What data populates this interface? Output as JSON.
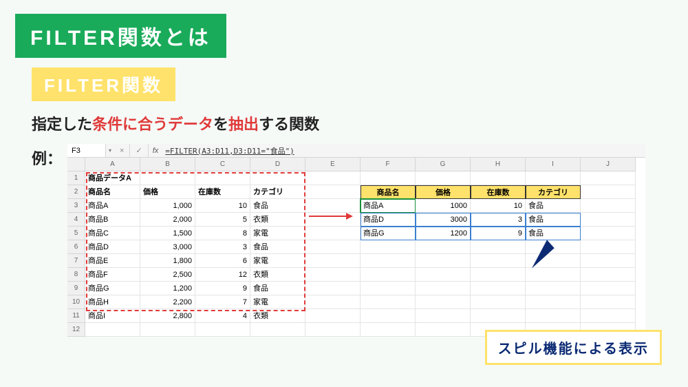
{
  "title": "FILTER関数とは",
  "subtitle": "FILTER関数",
  "description": {
    "p1": "指定した",
    "r1": "条件に合うデータ",
    "p2": "を",
    "r2": "抽出",
    "p3": "する関数"
  },
  "example_label": "例：",
  "formula_bar": {
    "cell_ref": "F3",
    "fx": "fx",
    "formula": "=FILTER(A3:D11,D3:D11=\"食品\")"
  },
  "columns": [
    "A",
    "B",
    "C",
    "D",
    "E",
    "F",
    "G",
    "H",
    "I",
    "J"
  ],
  "rows": [
    "1",
    "2",
    "3",
    "4",
    "5",
    "6",
    "7",
    "8",
    "9",
    "10",
    "11",
    "12"
  ],
  "source_title": "商品データA",
  "source_headers": [
    "商品名",
    "価格",
    "在庫数",
    "カテゴリ"
  ],
  "source_rows": [
    {
      "name": "商品A",
      "price": "1,000",
      "stock": "10",
      "cat": "食品"
    },
    {
      "name": "商品B",
      "price": "2,000",
      "stock": "5",
      "cat": "衣類"
    },
    {
      "name": "商品C",
      "price": "1,500",
      "stock": "8",
      "cat": "家電"
    },
    {
      "name": "商品D",
      "price": "3,000",
      "stock": "3",
      "cat": "食品"
    },
    {
      "name": "商品E",
      "price": "1,800",
      "stock": "6",
      "cat": "家電"
    },
    {
      "name": "商品F",
      "price": "2,500",
      "stock": "12",
      "cat": "衣類"
    },
    {
      "name": "商品G",
      "price": "1,200",
      "stock": "9",
      "cat": "食品"
    },
    {
      "name": "商品H",
      "price": "2,200",
      "stock": "7",
      "cat": "家電"
    },
    {
      "name": "商品I",
      "price": "2,800",
      "stock": "4",
      "cat": "衣類"
    }
  ],
  "result_headers": [
    "商品名",
    "価格",
    "在庫数",
    "カテゴリ"
  ],
  "result_rows": [
    {
      "name": "商品A",
      "price": "1000",
      "stock": "10",
      "cat": "食品"
    },
    {
      "name": "商品D",
      "price": "3000",
      "stock": "3",
      "cat": "食品"
    },
    {
      "name": "商品G",
      "price": "1200",
      "stock": "9",
      "cat": "食品"
    }
  ],
  "callout": "スピル機能による表示"
}
